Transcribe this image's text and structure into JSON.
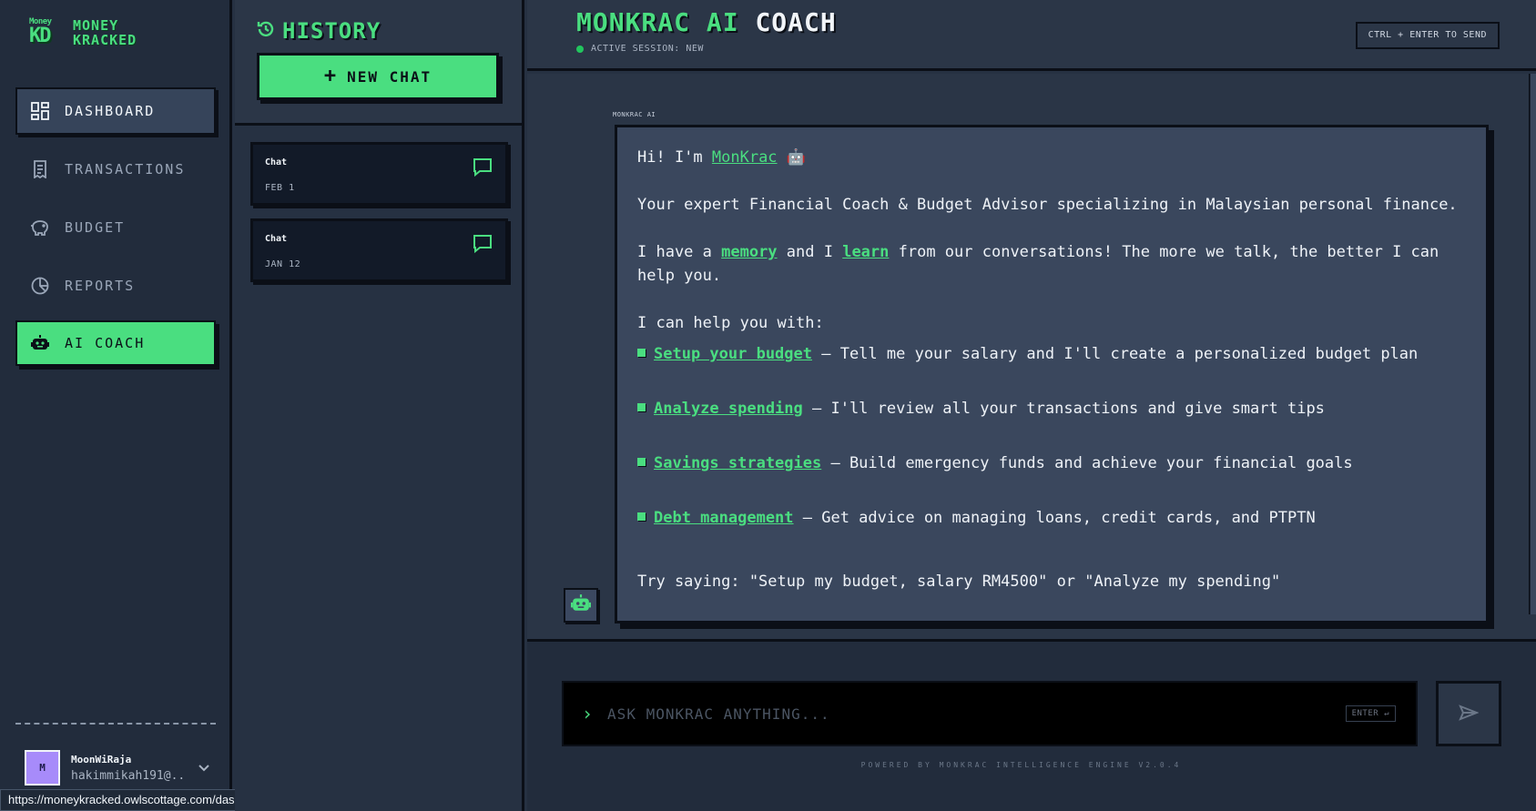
{
  "brand": {
    "logo_top": "Money",
    "logo_bottom": "KD",
    "name_line1": "MONEY",
    "name_line2": "KRACKED"
  },
  "nav": [
    {
      "label": "DASHBOARD",
      "icon": "dashboard-icon"
    },
    {
      "label": "TRANSACTIONS",
      "icon": "receipt-icon"
    },
    {
      "label": "BUDGET",
      "icon": "piggy-bank-icon"
    },
    {
      "label": "REPORTS",
      "icon": "pie-chart-icon"
    },
    {
      "label": "AI COACH",
      "icon": "robot-icon"
    }
  ],
  "user": {
    "initial": "M",
    "name": "MoonWiRaja",
    "email": "hakimmikah191@..."
  },
  "status_url": "https://moneykracked.owlscottage.com/dashboard",
  "history": {
    "title": "HISTORY",
    "new_chat": "NEW CHAT",
    "chats": [
      {
        "name": "Chat",
        "date": "FEB 1"
      },
      {
        "name": "Chat",
        "date": "JAN 12"
      }
    ]
  },
  "header": {
    "title_accent": "MONKRAC AI",
    "title_plain": "COACH",
    "session": "ACTIVE SESSION: NEW",
    "hint": "CTRL + ENTER TO SEND"
  },
  "message": {
    "sender": "MONKRAC AI",
    "greeting_pre": "Hi! I'm ",
    "greeting_name": "MonKrac",
    "greeting_emoji": "🤖",
    "intro": "Your expert Financial Coach & Budget Advisor specializing in Malaysian personal finance.",
    "memory_pre": "I have a ",
    "memory_word": "memory",
    "memory_mid": " and I ",
    "learn_word": "learn",
    "memory_post": " from our conversations! The more we talk, the better I can help you.",
    "help_intro": "I can help you with:",
    "items": [
      {
        "title": "Setup your budget",
        "desc": " – Tell me your salary and I'll create a personalized budget plan"
      },
      {
        "title": "Analyze spending",
        "desc": " – I'll review all your transactions and give smart tips"
      },
      {
        "title": "Savings strategies",
        "desc": " – Build emergency funds and achieve your financial goals"
      },
      {
        "title": "Debt management",
        "desc": " – Get advice on managing loans, credit cards, and PTPTN"
      }
    ],
    "try_text": "Try saying: \"Setup my budget, salary RM4500\" or \"Analyze my spending\""
  },
  "composer": {
    "placeholder": "ASK MONKRAC ANYTHING...",
    "enter_badge": "ENTER ↵",
    "powered": "POWERED BY MONKRAC INTELLIGENCE ENGINE V2.0.4"
  },
  "colors": {
    "accent": "#4ade80",
    "background": "#263142",
    "border": "#0b0f17"
  }
}
